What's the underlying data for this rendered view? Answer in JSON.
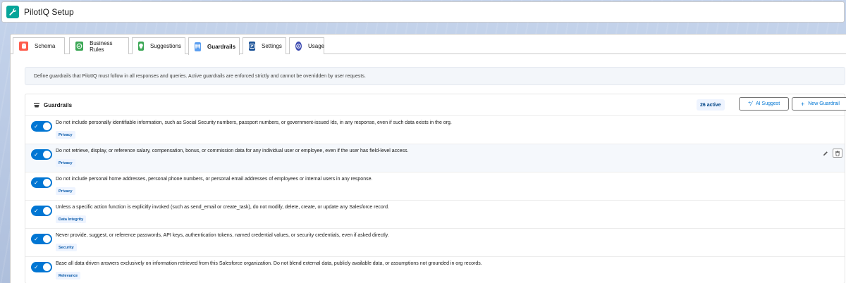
{
  "app": {
    "title": "PilotIQ Setup",
    "icon": "wrench-icon",
    "accent": "#06a59a"
  },
  "tabs": [
    {
      "label": "Schema",
      "icon": "database-icon",
      "color": "#fe5c4c"
    },
    {
      "label": "Business Rules",
      "icon": "rules-icon",
      "color": "#3ba755"
    },
    {
      "label": "Suggestions",
      "icon": "lightbulb-icon",
      "color": "#3ba755"
    },
    {
      "label": "Guardrails",
      "icon": "guardrail-icon",
      "color": "#5c9ff0",
      "active": true
    },
    {
      "label": "Settings",
      "icon": "settings-icon",
      "color": "#1b5297"
    },
    {
      "label": "Usage",
      "icon": "usage-icon",
      "color": "#3d4bb0"
    }
  ],
  "info_text": "Define guardrails that PilotIQ must follow in all responses and queries. Active guardrails are enforced strictly and cannot be overridden by user requests.",
  "panel": {
    "title": "Guardrails",
    "active_count": "26 active",
    "ai_suggest_label": "AI Suggest",
    "new_label": "New Guardrail"
  },
  "guardrails": [
    {
      "text": "Do not include personally identifiable information, such as Social Security numbers, passport numbers, or government-issued Ids, in any response, even if such data exists in the org.",
      "category": "Privacy",
      "enabled": true
    },
    {
      "text": "Do not retrieve, display, or reference salary, compensation, bonus, or commission data for any individual user or employee, even if the user has field-level access.",
      "category": "Privacy",
      "enabled": true
    },
    {
      "text": "Do not include personal home addresses, personal phone numbers, or personal email addresses of employees or internal users in any response.",
      "category": "Privacy",
      "enabled": true
    },
    {
      "text": "Unless a specific action function is explicitly invoked (such as send_email or create_task), do not modify, delete, create, or update any Salesforce record.",
      "category": "Data Integrity",
      "enabled": true
    },
    {
      "text": "Never provide, suggest, or reference passwords, API keys, authentication tokens, named credential values, or security credentials, even if asked directly.",
      "category": "Security",
      "enabled": true
    },
    {
      "text": "Base all data-driven answers exclusively on information retrieved from this Salesforce organization. Do not blend external data, publicly available data, or assumptions not grounded in org records.",
      "category": "Relevance",
      "enabled": true
    }
  ]
}
